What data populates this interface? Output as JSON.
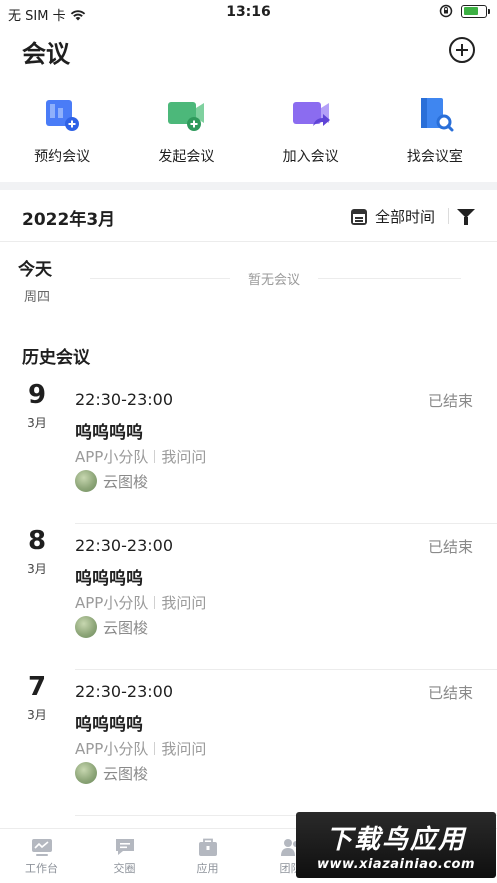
{
  "status_bar": {
    "carrier": "无 SIM 卡",
    "time": "13:16"
  },
  "header": {
    "title": "会议"
  },
  "actions": [
    {
      "label": "预约会议",
      "icon": "schedule-meeting-icon",
      "color": "#4a7cf7"
    },
    {
      "label": "发起会议",
      "icon": "start-meeting-icon",
      "color": "#4cb87a"
    },
    {
      "label": "加入会议",
      "icon": "join-meeting-icon",
      "color": "#8b6cf0"
    },
    {
      "label": "找会议室",
      "icon": "find-room-icon",
      "color": "#3f86f0"
    }
  ],
  "filter": {
    "month": "2022年3月",
    "range_label": "全部时间"
  },
  "today": {
    "day_label": "今天",
    "weekday": "周四",
    "empty_text": "暂无会议"
  },
  "history": {
    "title": "历史会议",
    "meetings": [
      {
        "day": "9",
        "month": "3月",
        "time": "22:30-23:00",
        "status": "已结束",
        "name": "呜呜呜呜",
        "team": "APP小分队",
        "creator": "我问问",
        "host": "云图梭"
      },
      {
        "day": "8",
        "month": "3月",
        "time": "22:30-23:00",
        "status": "已结束",
        "name": "呜呜呜呜",
        "team": "APP小分队",
        "creator": "我问问",
        "host": "云图梭"
      },
      {
        "day": "7",
        "month": "3月",
        "time": "22:30-23:00",
        "status": "已结束",
        "name": "呜呜呜呜",
        "team": "APP小分队",
        "creator": "我问问",
        "host": "云图梭"
      }
    ]
  },
  "tabbar": [
    {
      "label": "工作台",
      "icon": "workbench-icon"
    },
    {
      "label": "交圈",
      "icon": "chat-icon"
    },
    {
      "label": "应用",
      "icon": "apps-icon"
    },
    {
      "label": "团队",
      "icon": "team-icon"
    },
    {
      "label": "",
      "icon": "profile-icon"
    }
  ],
  "watermark": {
    "line1": "下载鸟应用",
    "line2": "www.xiazainiao.com"
  }
}
